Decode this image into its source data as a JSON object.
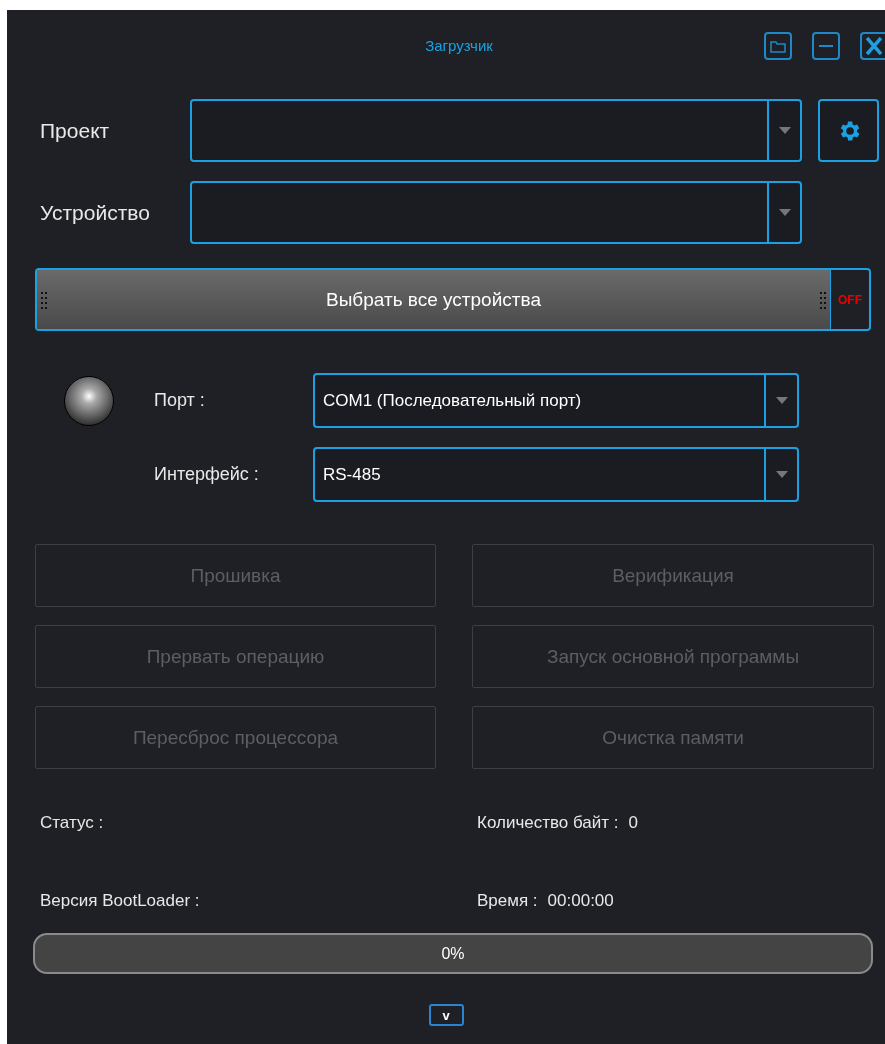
{
  "window": {
    "title": "Загрузчик"
  },
  "project": {
    "label": "Проект"
  },
  "device": {
    "label": "Устройство"
  },
  "select_all": {
    "label": "Выбрать все устройства",
    "on": false,
    "state_text": "OFF"
  },
  "connection": {
    "connected": false,
    "port": {
      "label": "Порт :",
      "value": "COM1 (Последовательный порт)"
    },
    "interface": {
      "label": "Интерфейс :",
      "value": "RS-485"
    }
  },
  "actions": [
    {
      "label": "Прошивка",
      "disabled": true
    },
    {
      "label": "Верификация",
      "disabled": true
    },
    {
      "label": "Прервать операцию",
      "disabled": true
    },
    {
      "label": "Запуск основной программы",
      "disabled": true
    },
    {
      "label": "Пересброс процессора",
      "disabled": true
    },
    {
      "label": "Очистка памяти",
      "disabled": true
    }
  ],
  "info": [
    {
      "label": "Статус :"
    },
    {
      "label": "Количество байт :",
      "value": "0"
    },
    {
      "label": "Версия BootLoader :"
    },
    {
      "label": "Время :",
      "value": "00:00:00"
    }
  ],
  "progress": {
    "level": 0,
    "text": "0%"
  },
  "expand_button": {
    "label": "v"
  }
}
